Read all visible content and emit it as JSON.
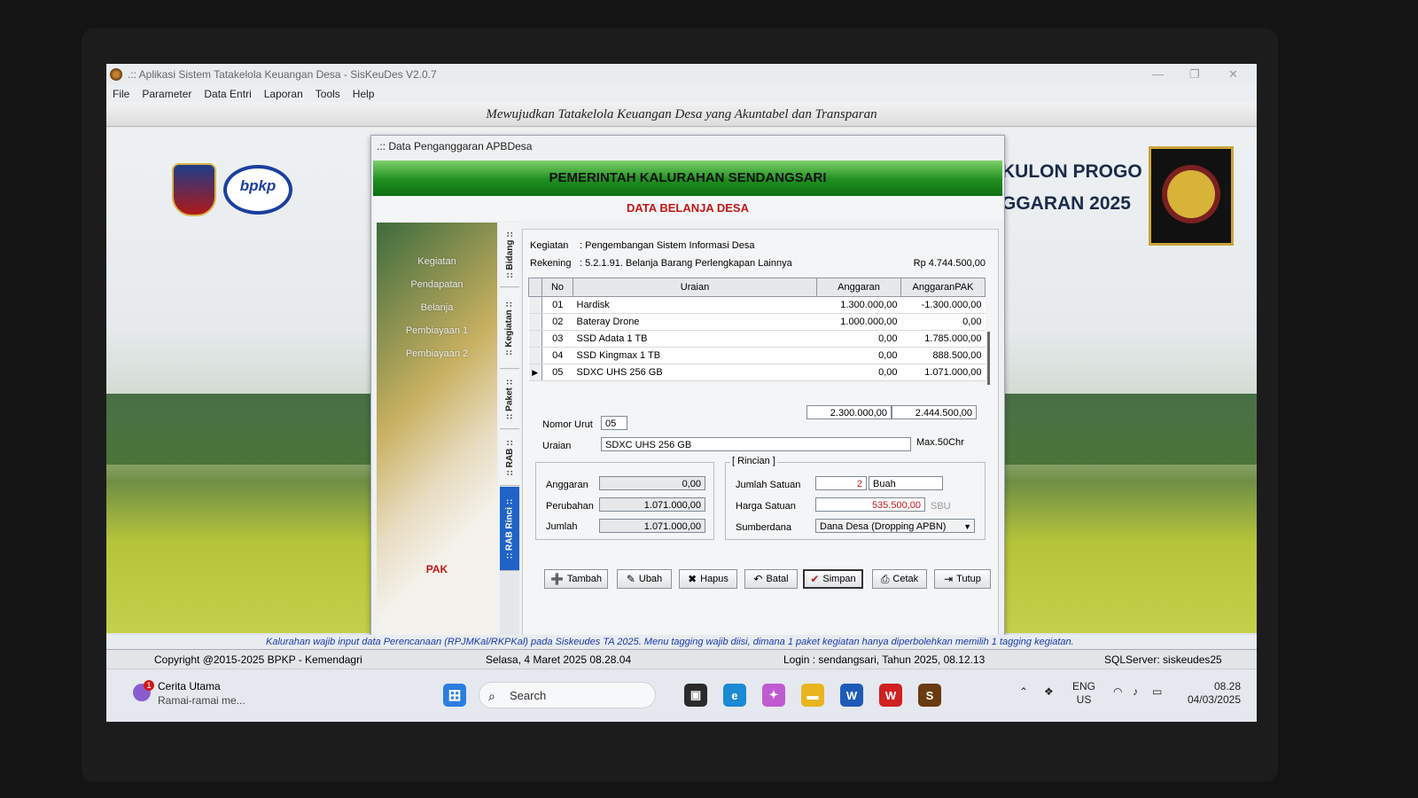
{
  "app": {
    "title": ".:: Aplikasi Sistem Tatakelola Keuangan Desa - SisKeuDes V2.0.7",
    "menu": [
      "File",
      "Parameter",
      "Data Entri",
      "Laporan",
      "Tools",
      "Help"
    ],
    "banner": "Mewujudkan Tatakelola Keuangan Desa yang Akuntabel dan Transparan",
    "logo_bpkp": "bpkp",
    "region_line1": "KULON PROGO",
    "region_line2": "GGARAN 2025"
  },
  "dialog": {
    "title": ".:: Data Penganggaran APBDesa",
    "header": "PEMERINTAH KALURAHAN SENDANGSARI",
    "subheader": "DATA BELANJA DESA",
    "left_menu": [
      "Kegiatan",
      "Pendapatan",
      "Belanja",
      "Pembiayaan 1",
      "Pembiayaan 2"
    ],
    "pak_label": "PAK",
    "tabs": [
      ":: Bidang ::",
      ":: Kegiatan ::",
      ":: Paket ::",
      ":: RAB ::",
      ":: RAB Rinci ::"
    ],
    "kegiatan_label": "Kegiatan",
    "kegiatan_value": ":  Pengembangan Sistem Informasi Desa",
    "rekening_label": "Rekening",
    "rekening_value": ":  5.2.1.91.  Belanja Barang Perlengkapan Lainnya",
    "total_amount": "Rp 4.744.500,00",
    "table": {
      "headers": [
        "No",
        "Uraian",
        "Anggaran",
        "AnggaranPAK"
      ],
      "rows": [
        {
          "no": "01",
          "uraian": "Hardisk",
          "anggaran": "1.300.000,00",
          "pak": "-1.300.000,00"
        },
        {
          "no": "02",
          "uraian": "Bateray Drone",
          "anggaran": "1.000.000,00",
          "pak": "0,00"
        },
        {
          "no": "03",
          "uraian": "SSD Adata 1 TB",
          "anggaran": "0,00",
          "pak": "1.785.000,00"
        },
        {
          "no": "04",
          "uraian": "SSD Kingmax 1 TB",
          "anggaran": "0,00",
          "pak": "888.500,00"
        },
        {
          "no": "05",
          "uraian": "SDXC UHS 256 GB",
          "anggaran": "0,00",
          "pak": "1.071.000,00",
          "selected_marker": "▶"
        }
      ]
    },
    "form": {
      "nomor_urut_label": "Nomor Urut",
      "nomor_urut_value": "05",
      "sum_anggaran": "2.300.000,00",
      "sum_pak": "2.444.500,00",
      "uraian_label": "Uraian",
      "uraian_value": "SDXC UHS 256 GB",
      "max_note": "Max.50Chr",
      "anggaran_label": "Anggaran",
      "anggaran_value": "0,00",
      "perubahan_label": "Perubahan",
      "perubahan_value": "1.071.000,00",
      "jumlah_label": "Jumlah",
      "jumlah_value": "1.071.000,00",
      "rincian_title": "[ Rincian ]",
      "jumlah_satuan_label": "Jumlah Satuan",
      "jumlah_satuan_value": "2",
      "satuan_value": "Buah",
      "harga_satuan_label": "Harga Satuan",
      "harga_satuan_value": "535.500,00",
      "sbu_label": "SBU",
      "sumberdana_label": "Sumberdana",
      "sumberdana_value": "Dana Desa (Dropping APBN)"
    },
    "buttons": {
      "tambah": "Tambah",
      "ubah": "Ubah",
      "hapus": "Hapus",
      "batal": "Batal",
      "simpan": "Simpan",
      "cetak": "Cetak",
      "tutup": "Tutup"
    }
  },
  "ticker": "Kalurahan wajib input data Perencanaan (RPJMKal/RKPKal) pada Siskeudes TA 2025. Menu tagging wajib diisi, dimana 1 paket kegiatan hanya diperbolehkan memilih 1 tagging kegiatan.",
  "status": {
    "copyright": "Copyright @2015-2025 BPKP - Kemendagri",
    "datetime": "Selasa, 4 Maret 2025  08.28.04",
    "login": "Login : sendangsari,  Tahun 2025, 08.12.13",
    "server": "SQLServer: siskeudes25"
  },
  "taskbar": {
    "news_title": "Cerita Utama",
    "news_sub": "Ramai-ramai me...",
    "news_badge": "1",
    "search_placeholder": "Search",
    "lang1": "ENG",
    "lang2": "US",
    "time": "08.28",
    "date": "04/03/2025"
  },
  "colors": {
    "header_green": "#1f8f1f",
    "accent_red": "#c01818",
    "tab_active": "#1f63c8",
    "ticker_blue": "#1a3aa8"
  }
}
